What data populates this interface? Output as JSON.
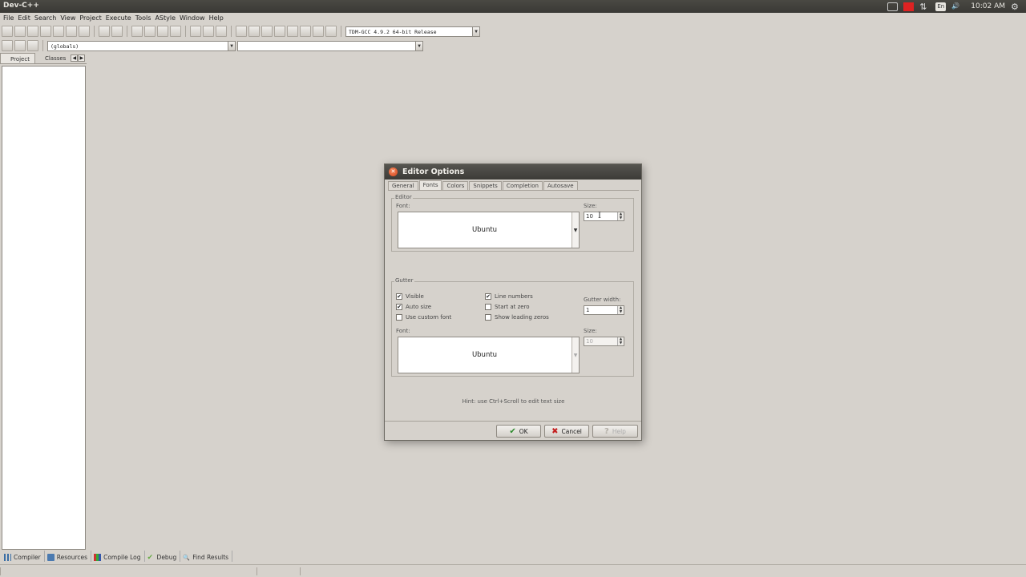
{
  "app": {
    "title": "Dev-C++"
  },
  "tray": {
    "lang": "En",
    "clock": "10:02 AM"
  },
  "menu": [
    "File",
    "Edit",
    "Search",
    "View",
    "Project",
    "Execute",
    "Tools",
    "AStyle",
    "Window",
    "Help"
  ],
  "toolbar": {
    "compiler_select": "TDM-GCC 4.9.2 64-bit Release",
    "scope_select": "(globals)",
    "function_select": ""
  },
  "left_panel": {
    "tabs": [
      "Project",
      "Classes"
    ]
  },
  "bottom_tabs": [
    {
      "label": "Compiler",
      "icon": "compiler-icon"
    },
    {
      "label": "Resources",
      "icon": "resources-icon"
    },
    {
      "label": "Compile Log",
      "icon": "compile-log-icon"
    },
    {
      "label": "Debug",
      "icon": "debug-icon"
    },
    {
      "label": "Find Results",
      "icon": "find-icon"
    }
  ],
  "dialog": {
    "title": "Editor Options",
    "tabs": [
      "General",
      "Fonts",
      "Colors",
      "Snippets",
      "Completion",
      "Autosave"
    ],
    "active_tab": "Fonts",
    "editor_group": {
      "label": "Editor",
      "font_label": "Font:",
      "font_value": "Ubuntu",
      "size_label": "Size:",
      "size_value": "10"
    },
    "gutter_group": {
      "label": "Gutter",
      "visible": {
        "label": "Visible",
        "checked": true
      },
      "auto_size": {
        "label": "Auto size",
        "checked": true
      },
      "use_custom_font": {
        "label": "Use custom font",
        "checked": false
      },
      "line_numbers": {
        "label": "Line numbers",
        "checked": true
      },
      "start_at_zero": {
        "label": "Start at zero",
        "checked": false
      },
      "show_leading_zeros": {
        "label": "Show leading zeros",
        "checked": false
      },
      "gutter_width_label": "Gutter width:",
      "gutter_width_value": "1",
      "font_label": "Font:",
      "font_value": "Ubuntu",
      "size_label": "Size:",
      "size_value": "10"
    },
    "hint": "Hint: use Ctrl+Scroll to edit text size",
    "buttons": {
      "ok": "OK",
      "cancel": "Cancel",
      "help": "Help"
    }
  }
}
